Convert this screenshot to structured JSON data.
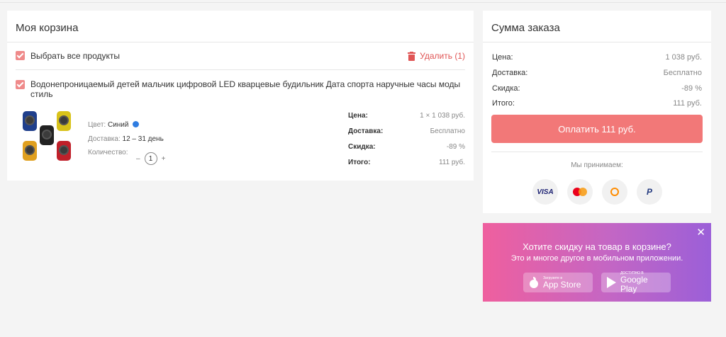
{
  "cart": {
    "title": "Моя корзина",
    "select_all_label": "Выбрать все продукты",
    "delete_label": "Удалить (1)",
    "item": {
      "title": "Водонепроницаемый детей мальчик цифровой LED кварцевые будильник Дата спорта наручные часы моды стиль",
      "color_label": "Цвет:",
      "color_value": "Синий",
      "delivery_label": "Доставка:",
      "delivery_value": "12 – 31 день",
      "quantity_label": "Количество:",
      "quantity_minus": "–",
      "quantity_value": "1",
      "quantity_plus": "+",
      "price_rows": [
        {
          "label": "Цена:",
          "value": "1 × 1 038 руб."
        },
        {
          "label": "Доставка:",
          "value": "Бесплатно"
        },
        {
          "label": "Скидка:",
          "value": "-89 %"
        },
        {
          "label": "Итого:",
          "value": "111 руб."
        }
      ]
    }
  },
  "summary": {
    "title": "Сумма заказа",
    "rows": [
      {
        "label": "Цена:",
        "value": "1 038 руб."
      },
      {
        "label": "Доставка:",
        "value": "Бесплатно"
      },
      {
        "label": "Скидка:",
        "value": "-89 %"
      },
      {
        "label": "Итого:",
        "value": "111 руб."
      }
    ],
    "pay_button": "Оплатить 111 руб.",
    "accept_label": "Мы принимаем:",
    "payment_icons": [
      "visa-icon",
      "mastercard-icon",
      "qiwi-icon",
      "paypal-icon"
    ],
    "visa_text": "VISA",
    "paypal_text": "P"
  },
  "promo": {
    "close": "✕",
    "title": "Хотите скидку на товар в корзине?",
    "subtitle": "Это и многое другое в мобильном приложении.",
    "appstore_small": "Загрузите в",
    "appstore_big": "App Store",
    "googleplay_small": "ДОСТУПНО В",
    "googleplay_big": "Google Play"
  },
  "colors": {
    "accent": "#f27878",
    "delete": "#e05555",
    "color_swatch": "#2f7de1"
  }
}
